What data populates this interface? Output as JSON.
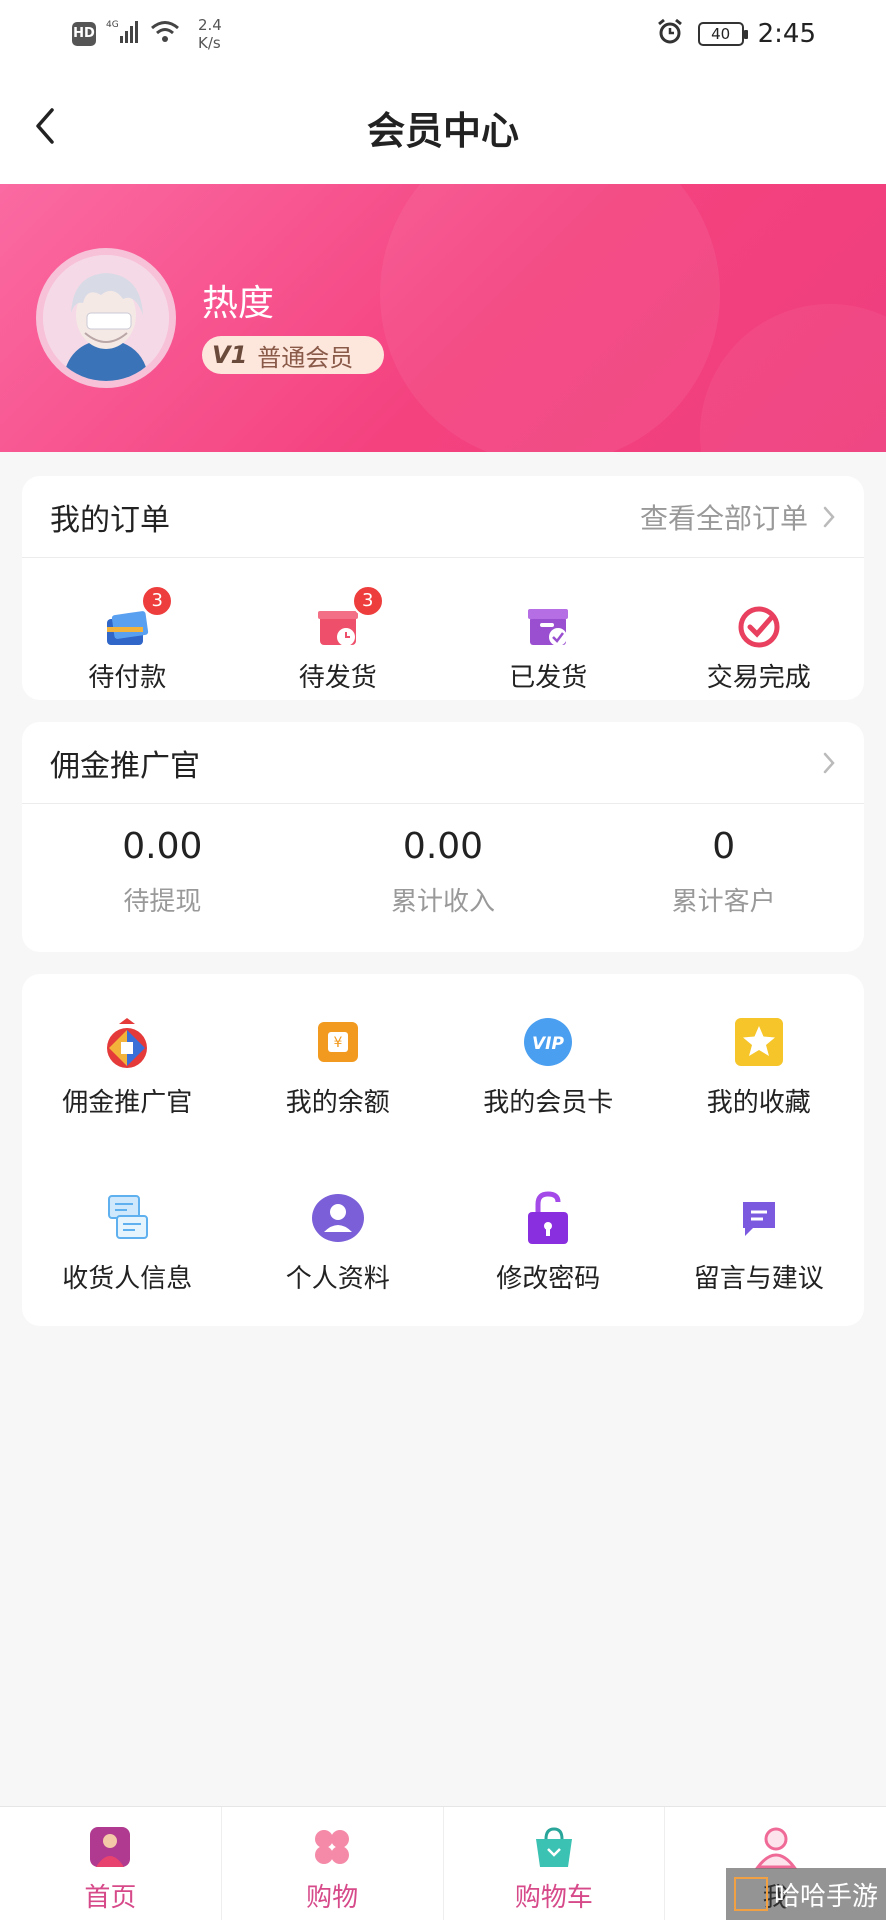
{
  "status_bar": {
    "network": "4G",
    "speed_value": "2.4",
    "speed_unit": "K/s",
    "battery": "40",
    "time": "2:45"
  },
  "nav": {
    "title": "会员中心"
  },
  "profile": {
    "name": "热度",
    "level_code": "V1",
    "level": "普通会员"
  },
  "orders": {
    "title": "我的订单",
    "view_all": "查看全部订单",
    "items": [
      {
        "label": "待付款",
        "icon": "card-wallet-icon",
        "badge": "3"
      },
      {
        "label": "待发货",
        "icon": "pending-box-icon",
        "badge": "3"
      },
      {
        "label": "已发货",
        "icon": "shipped-box-icon",
        "badge": ""
      },
      {
        "label": "交易完成",
        "icon": "completed-check-icon",
        "badge": ""
      }
    ]
  },
  "promoter": {
    "title": "佣金推广官",
    "stats": [
      {
        "value": "0.00",
        "label": "待提现"
      },
      {
        "value": "0.00",
        "label": "累计收入"
      },
      {
        "value": "0",
        "label": "累计客户"
      }
    ]
  },
  "menu": {
    "items": [
      {
        "label": "佣金推广官",
        "icon": "money-bag-icon"
      },
      {
        "label": "我的余额",
        "icon": "wallet-icon"
      },
      {
        "label": "我的会员卡",
        "icon": "vip-icon"
      },
      {
        "label": "我的收藏",
        "icon": "star-icon"
      },
      {
        "label": "收货人信息",
        "icon": "address-icon"
      },
      {
        "label": "个人资料",
        "icon": "profile-icon"
      },
      {
        "label": "修改密码",
        "icon": "lock-icon"
      },
      {
        "label": "留言与建议",
        "icon": "message-icon"
      }
    ]
  },
  "tabs": [
    {
      "label": "首页",
      "icon": "home-icon"
    },
    {
      "label": "购物",
      "icon": "shop-icon"
    },
    {
      "label": "购物车",
      "icon": "cart-icon"
    },
    {
      "label": "我",
      "icon": "user-icon",
      "active": true
    }
  ],
  "watermark": {
    "text": "哈哈手游"
  },
  "colors": {
    "brand_pink": "#f4427f",
    "badge_red": "#ee3d3d",
    "tab_pink": "#d64a8a"
  }
}
